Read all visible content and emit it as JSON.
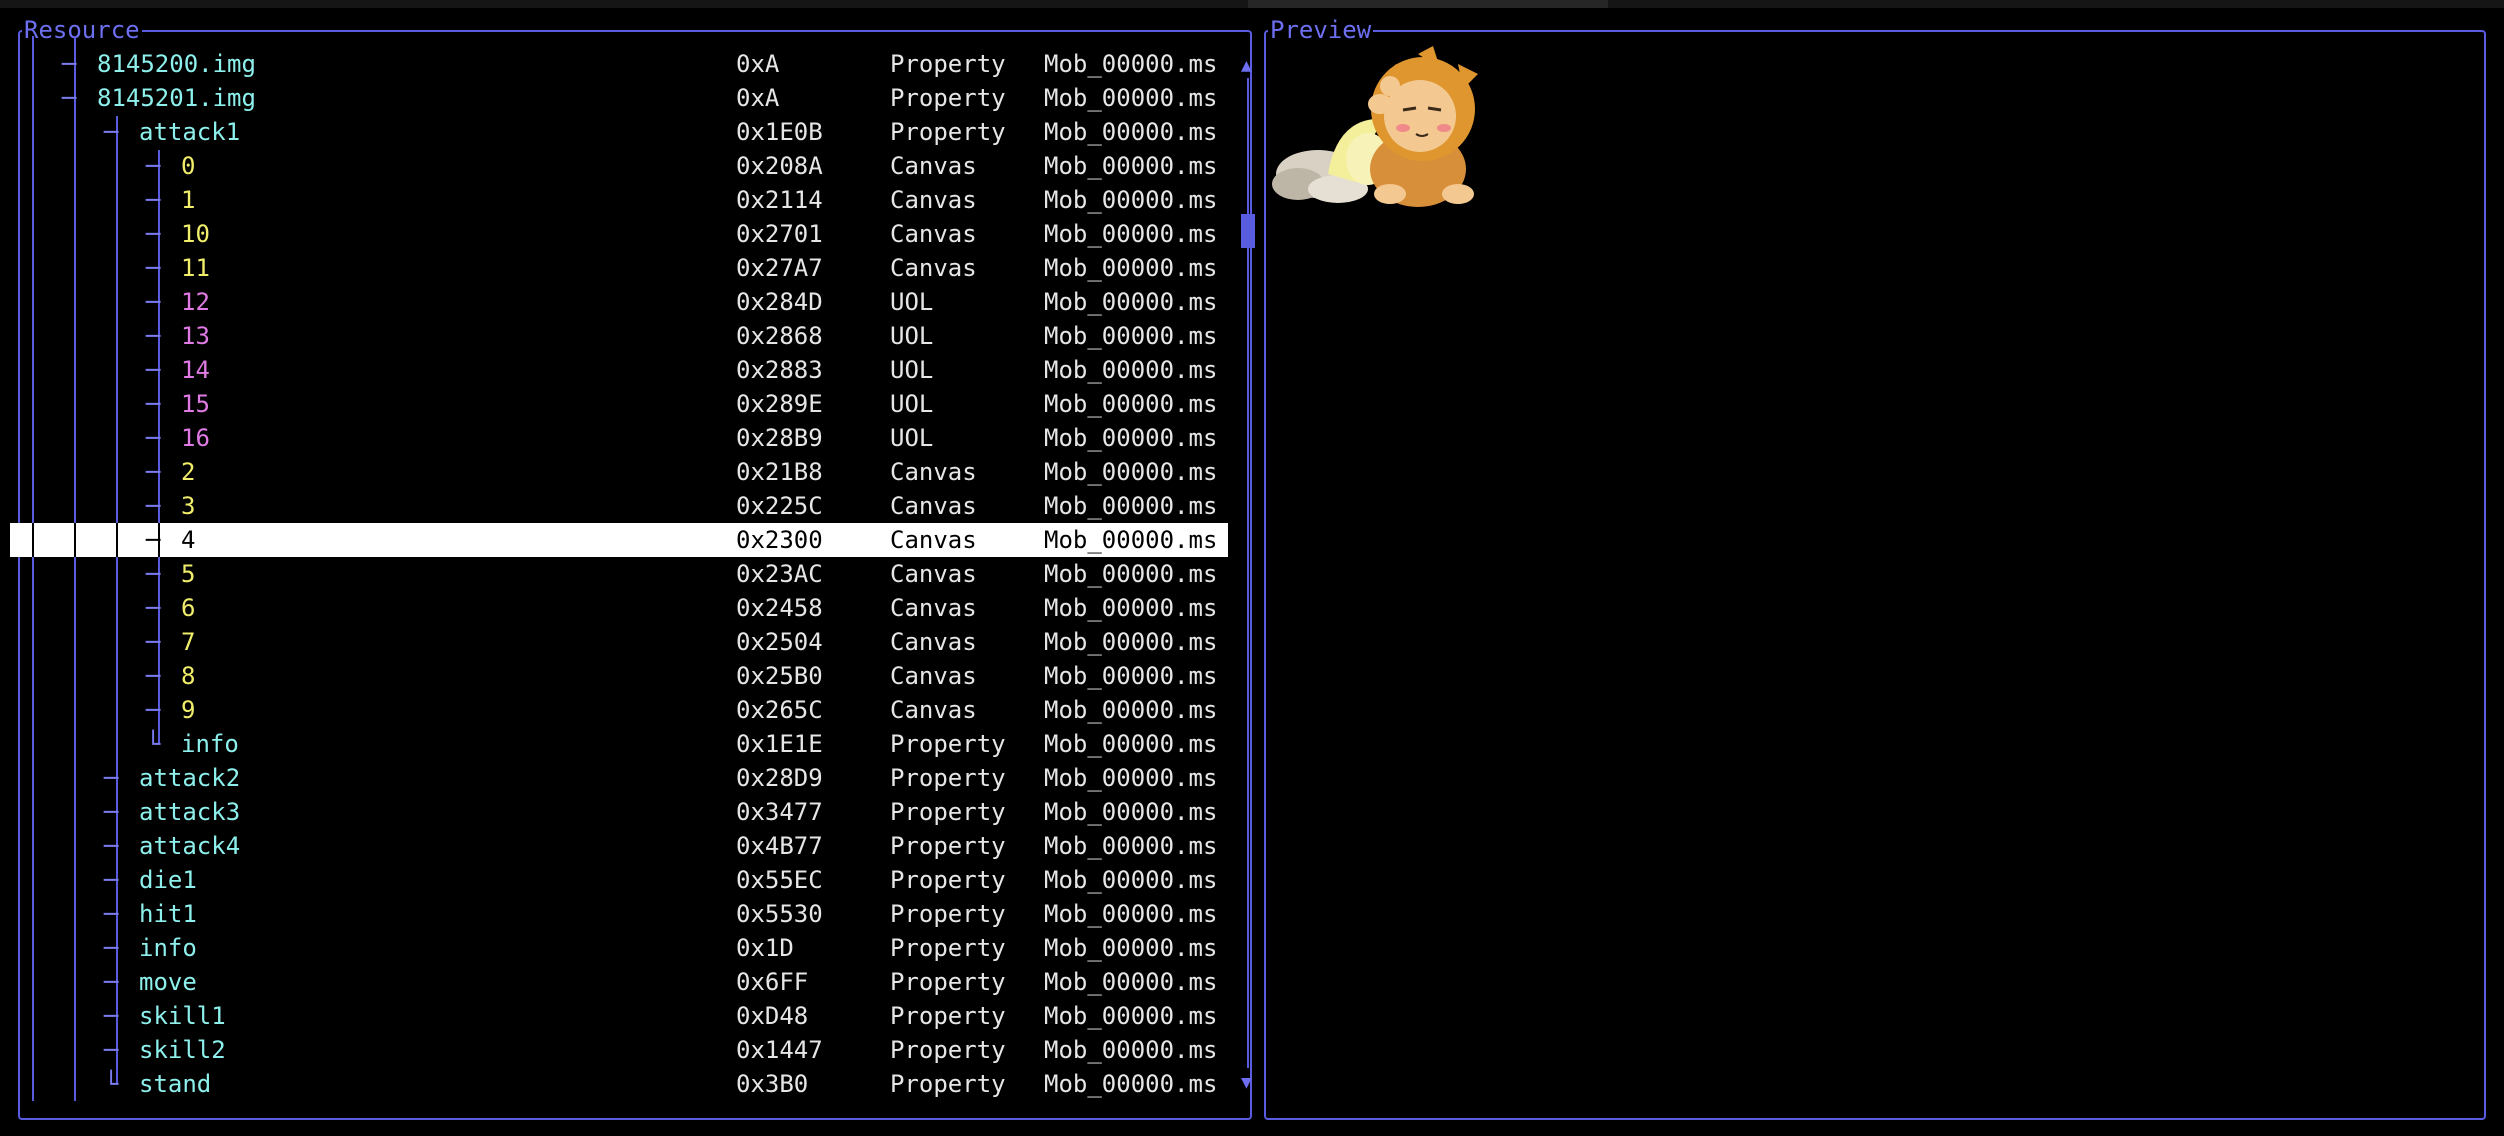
{
  "panels": {
    "resource_title": "Resource",
    "preview_title": "Preview"
  },
  "rows": [
    {
      "name": "8145200.img",
      "addr": "0xA",
      "type": "Property",
      "file": "Mob_00000.ms",
      "color": "cyan",
      "depth": 1,
      "branch": "─"
    },
    {
      "name": "8145201.img",
      "addr": "0xA",
      "type": "Property",
      "file": "Mob_00000.ms",
      "color": "cyan",
      "depth": 1,
      "branch": "─"
    },
    {
      "name": "attack1",
      "addr": "0x1E0B",
      "type": "Property",
      "file": "Mob_00000.ms",
      "color": "cyan",
      "depth": 2,
      "branch": "─"
    },
    {
      "name": "0",
      "addr": "0x208A",
      "type": "Canvas",
      "file": "Mob_00000.ms",
      "color": "yellow",
      "depth": 3,
      "branch": "─"
    },
    {
      "name": "1",
      "addr": "0x2114",
      "type": "Canvas",
      "file": "Mob_00000.ms",
      "color": "yellow",
      "depth": 3,
      "branch": "─"
    },
    {
      "name": "10",
      "addr": "0x2701",
      "type": "Canvas",
      "file": "Mob_00000.ms",
      "color": "yellow",
      "depth": 3,
      "branch": "─"
    },
    {
      "name": "11",
      "addr": "0x27A7",
      "type": "Canvas",
      "file": "Mob_00000.ms",
      "color": "yellow",
      "depth": 3,
      "branch": "─"
    },
    {
      "name": "12",
      "addr": "0x284D",
      "type": "UOL",
      "file": "Mob_00000.ms",
      "color": "pink",
      "depth": 3,
      "branch": "─"
    },
    {
      "name": "13",
      "addr": "0x2868",
      "type": "UOL",
      "file": "Mob_00000.ms",
      "color": "pink",
      "depth": 3,
      "branch": "─"
    },
    {
      "name": "14",
      "addr": "0x2883",
      "type": "UOL",
      "file": "Mob_00000.ms",
      "color": "pink",
      "depth": 3,
      "branch": "─"
    },
    {
      "name": "15",
      "addr": "0x289E",
      "type": "UOL",
      "file": "Mob_00000.ms",
      "color": "pink",
      "depth": 3,
      "branch": "─"
    },
    {
      "name": "16",
      "addr": "0x28B9",
      "type": "UOL",
      "file": "Mob_00000.ms",
      "color": "pink",
      "depth": 3,
      "branch": "─"
    },
    {
      "name": "2",
      "addr": "0x21B8",
      "type": "Canvas",
      "file": "Mob_00000.ms",
      "color": "yellow",
      "depth": 3,
      "branch": "─"
    },
    {
      "name": "3",
      "addr": "0x225C",
      "type": "Canvas",
      "file": "Mob_00000.ms",
      "color": "yellow",
      "depth": 3,
      "branch": "─"
    },
    {
      "name": "4",
      "addr": "0x2300",
      "type": "Canvas",
      "file": "Mob_00000.ms",
      "color": "yellow",
      "depth": 3,
      "branch": "─",
      "selected": true
    },
    {
      "name": "5",
      "addr": "0x23AC",
      "type": "Canvas",
      "file": "Mob_00000.ms",
      "color": "yellow",
      "depth": 3,
      "branch": "─"
    },
    {
      "name": "6",
      "addr": "0x2458",
      "type": "Canvas",
      "file": "Mob_00000.ms",
      "color": "yellow",
      "depth": 3,
      "branch": "─"
    },
    {
      "name": "7",
      "addr": "0x2504",
      "type": "Canvas",
      "file": "Mob_00000.ms",
      "color": "yellow",
      "depth": 3,
      "branch": "─"
    },
    {
      "name": "8",
      "addr": "0x25B0",
      "type": "Canvas",
      "file": "Mob_00000.ms",
      "color": "yellow",
      "depth": 3,
      "branch": "─"
    },
    {
      "name": "9",
      "addr": "0x265C",
      "type": "Canvas",
      "file": "Mob_00000.ms",
      "color": "yellow",
      "depth": 3,
      "branch": "─"
    },
    {
      "name": "info",
      "addr": "0x1E1E",
      "type": "Property",
      "file": "Mob_00000.ms",
      "color": "cyan",
      "depth": 3,
      "branch": "└"
    },
    {
      "name": "attack2",
      "addr": "0x28D9",
      "type": "Property",
      "file": "Mob_00000.ms",
      "color": "cyan",
      "depth": 2,
      "branch": "─"
    },
    {
      "name": "attack3",
      "addr": "0x3477",
      "type": "Property",
      "file": "Mob_00000.ms",
      "color": "cyan",
      "depth": 2,
      "branch": "─"
    },
    {
      "name": "attack4",
      "addr": "0x4B77",
      "type": "Property",
      "file": "Mob_00000.ms",
      "color": "cyan",
      "depth": 2,
      "branch": "─"
    },
    {
      "name": "die1",
      "addr": "0x55EC",
      "type": "Property",
      "file": "Mob_00000.ms",
      "color": "cyan",
      "depth": 2,
      "branch": "─"
    },
    {
      "name": "hit1",
      "addr": "0x5530",
      "type": "Property",
      "file": "Mob_00000.ms",
      "color": "cyan",
      "depth": 2,
      "branch": "─"
    },
    {
      "name": "info",
      "addr": "0x1D",
      "type": "Property",
      "file": "Mob_00000.ms",
      "color": "cyan",
      "depth": 2,
      "branch": "─"
    },
    {
      "name": "move",
      "addr": "0x6FF",
      "type": "Property",
      "file": "Mob_00000.ms",
      "color": "cyan",
      "depth": 2,
      "branch": "─"
    },
    {
      "name": "skill1",
      "addr": "0xD48",
      "type": "Property",
      "file": "Mob_00000.ms",
      "color": "cyan",
      "depth": 2,
      "branch": "─"
    },
    {
      "name": "skill2",
      "addr": "0x1447",
      "type": "Property",
      "file": "Mob_00000.ms",
      "color": "cyan",
      "depth": 2,
      "branch": "─"
    },
    {
      "name": "stand",
      "addr": "0x3B0",
      "type": "Property",
      "file": "Mob_00000.ms",
      "color": "cyan",
      "depth": 2,
      "branch": "└"
    }
  ],
  "scrollbar": {
    "up_arrow": "▲",
    "down_arrow": "▼"
  },
  "colors": {
    "border": "#5a5ce0",
    "cyan": "#8ef0ec",
    "yellow": "#f0ee6a",
    "pink": "#e07ae4"
  },
  "icons": {
    "preview": "lion-mob-sprite"
  }
}
